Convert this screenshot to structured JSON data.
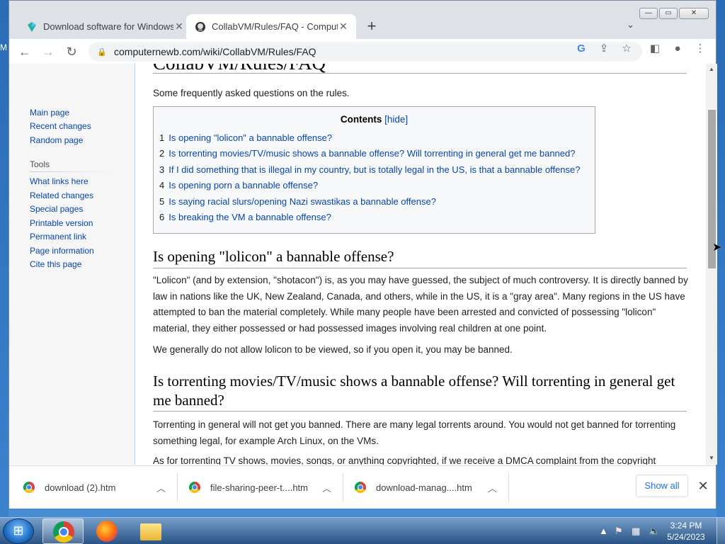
{
  "desktop": {
    "edge_label": "M"
  },
  "browser": {
    "tabs": [
      {
        "title": "Download software for Windows",
        "active": false
      },
      {
        "title": "CollabVM/Rules/FAQ - Computer",
        "active": true
      }
    ],
    "new_tab_icon": "plus-icon",
    "url": "computernewb.com/wiki/CollabVM/Rules/FAQ",
    "window_buttons": [
      "minimize",
      "maximize",
      "close"
    ]
  },
  "sidebar": {
    "nav": [
      "Main page",
      "Recent changes",
      "Random page"
    ],
    "tools_heading": "Tools",
    "tools": [
      "What links here",
      "Related changes",
      "Special pages",
      "Printable version",
      "Permanent link",
      "Page information",
      "Cite this page"
    ]
  },
  "article": {
    "title": "CollabVM/Rules/FAQ",
    "intro": "Some frequently asked questions on the rules.",
    "toc": {
      "heading": "Contents",
      "hide_label": "[hide]",
      "items": [
        {
          "num": "1",
          "text": "Is opening \"lolicon\" a bannable offense?"
        },
        {
          "num": "2",
          "text": "Is torrenting movies/TV/music shows a bannable offense? Will torrenting in general get me banned?"
        },
        {
          "num": "3",
          "text": "If I did something that is illegal in my country, but is totally legal in the US, is that a bannable offense?"
        },
        {
          "num": "4",
          "text": "Is opening porn a bannable offense?"
        },
        {
          "num": "5",
          "text": "Is saying racial slurs/opening Nazi swastikas a bannable offense?"
        },
        {
          "num": "6",
          "text": "Is breaking the VM a bannable offense?"
        }
      ]
    },
    "sections": [
      {
        "heading": "Is opening \"lolicon\" a bannable offense?",
        "paragraphs": [
          "\"Lolicon\" (and by extension, \"shotacon\") is, as you may have guessed, the subject of much controversy. It is directly banned by law in nations like the UK, New Zealand, Canada, and others, while in the US, it is a \"gray area\". Many regions in the US have attempted to ban the material completely. While many people have been arrested and convicted of possessing \"lolicon\" material, they either possessed or had possessed images involving real children at one point.",
          "We generally do not allow lolicon to be viewed, so if you open it, you may be banned."
        ]
      },
      {
        "heading": "Is torrenting movies/TV/music shows a bannable offense? Will torrenting in general get me banned?",
        "paragraphs": [
          "Torrenting in general will not get you banned. There are many legal torrents around. You would not get banned for torrenting something legal, for example Arch Linux, on the VMs.",
          "As for torrenting TV shows, movies, songs, or anything copyrighted, if we receive a DMCA complaint from the copyright"
        ]
      }
    ]
  },
  "downloads": {
    "items": [
      "download (2).htm",
      "file-sharing-peer-t....htm",
      "download-manag....htm"
    ],
    "show_all": "Show all"
  },
  "taskbar": {
    "apps": [
      "chrome",
      "firefox",
      "file-explorer"
    ],
    "time": "3:24 PM",
    "date": "5/24/2023"
  }
}
